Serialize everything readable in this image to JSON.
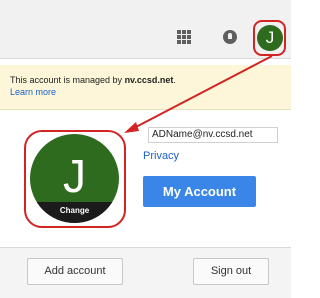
{
  "header": {
    "avatar_letter": "J",
    "icons": [
      "apps-grid-icon",
      "notifications-icon"
    ]
  },
  "notice": {
    "managed_prefix": "This account is managed by ",
    "managed_domain": "nv.ccsd.net",
    "managed_suffix": ".",
    "learn_more": "Learn more"
  },
  "account": {
    "avatar_letter": "J",
    "change_label": "Change",
    "email": "ADName@nv.ccsd.net",
    "privacy_label": "Privacy",
    "my_account_label": "My Account"
  },
  "footer": {
    "add_account_label": "Add account",
    "sign_out_label": "Sign out"
  },
  "colors": {
    "avatar_green": "#2e6b1e",
    "highlight_red": "#d32424",
    "accent_blue": "#3a86e8",
    "notice_yellow": "#fdf6d8"
  }
}
